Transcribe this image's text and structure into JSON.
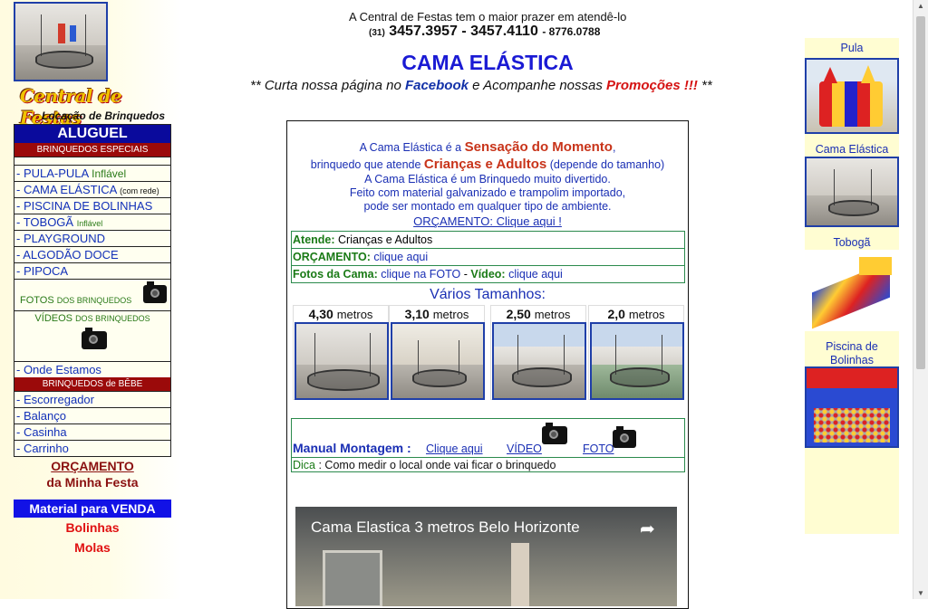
{
  "header": {
    "line1": "A Central de Festas tem o maior prazer em atendê-lo",
    "area_code": "(31)",
    "phones": "3457.3957 - 3457.4110",
    "phone_extra": "- 8776.0788",
    "title": "CAMA ELÁSTICA",
    "sub_pre": "** Curta nossa página no ",
    "sub_facebook": "Facebook",
    "sub_mid": " e Acompanhe nossas ",
    "sub_promo": "Promoções !!!",
    "sub_post": " **"
  },
  "logo": {
    "name": "Central de Festas",
    "tagline": "Locação de Brinquedos"
  },
  "sidebar": {
    "aluguel": "ALUGUEL",
    "especiais": "BRINQUEDOS ESPECIAIS",
    "items": [
      {
        "label": "- PULA-PULA",
        "extra": "Inflável"
      },
      {
        "label": "- CAMA ELÁSTICA",
        "extra": "(com rede)"
      },
      {
        "label": "- PISCINA DE BOLINHAS",
        "extra": ""
      },
      {
        "label": "- TOBOGÃ",
        "extra": "Inflável"
      },
      {
        "label": "- PLAYGROUND",
        "extra": ""
      },
      {
        "label": "- ALGODÃO DOCE",
        "extra": ""
      },
      {
        "label": "- PIPOCA",
        "extra": ""
      }
    ],
    "fotos_a": "FOTOS",
    "fotos_b": "DOS BRINQUEDOS",
    "videos_a": "VÍDEOS",
    "videos_b": "DOS BRINQUEDOS",
    "onde": "- Onde Estamos",
    "bebe": "BRINQUEDOS de BÊBE",
    "bebe_items": [
      "- Escorregador",
      "- Balanço",
      "- Casinha",
      "- Carrinho"
    ],
    "orcamento1": "ORÇAMENTO",
    "orcamento2": "da Minha Festa",
    "material": "Material para VENDA",
    "bolinhas": "Bolinhas",
    "molas": "Molas"
  },
  "main": {
    "intro1_a": "A Cama Elástica é a ",
    "intro1_b": "Sensação do Momento",
    "intro1_c": ",",
    "intro2_a": "brinquedo que atende ",
    "intro2_b": "Crianças e Adultos",
    "intro2_c": " (depende do tamanho)",
    "intro3": "A Cama Elástica é um Brinquedo muito divertido.",
    "intro4": "Feito com material galvanizado e trampolim importado,",
    "intro5": "pode ser montado em qualquer tipo de ambiente.",
    "orcamento_link": "ORÇAMENTO: Clique aqui !",
    "atende_label": "Atende:",
    "atende_value": "Crianças e Adultos",
    "orc_label": "ORÇAMENTO:",
    "orc_value": "clique aqui",
    "fotos_label": "Fotos da Cama:",
    "fotos_value": "clique na FOTO",
    "sep": " - ",
    "video_label": "Vídeo:",
    "video_value": "clique aqui",
    "varios": "Vários Tamanhos:",
    "sizes": [
      {
        "value": "4,30",
        "unit": "metros"
      },
      {
        "value": "3,10",
        "unit": "metros"
      },
      {
        "value": "2,50",
        "unit": "metros"
      },
      {
        "value": "2,0",
        "unit": "metros"
      }
    ],
    "manual_label": "Manual Montagem",
    "manual_sep": " : ",
    "manual_link": "Clique aqui",
    "video_link": "VÍDEO",
    "foto_link": "FOTO",
    "dica_label": "Dica",
    "dica_text": " : Como medir o local onde vai ficar o brinquedo",
    "video_title": "Cama Elastica 3 metros Belo Horizonte"
  },
  "right": {
    "items": [
      "Pula",
      "Cama Elástica",
      "Tobogã",
      "Piscina de",
      "Bolinhas"
    ]
  },
  "colors": {
    "accent_blue": "#1a1ad4",
    "menu_blue": "#0a0a9c",
    "menu_red": "#9b0a0a",
    "highlight": "#c8341a"
  }
}
